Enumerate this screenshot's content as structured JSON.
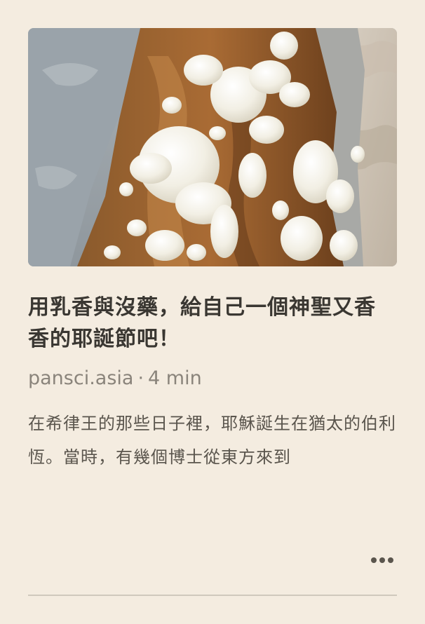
{
  "article": {
    "image_alt": "乳香",
    "title": "用乳香與沒藥，給自己一個神聖又香香的耶誕節吧！",
    "source": "pansci.asia",
    "separator": "·",
    "read_time": "4 min",
    "excerpt": "在希律王的那些日子裡，耶穌誕生在猶太的伯利恆。當時，有幾個博士從東方來到"
  },
  "actions": {
    "more_icon": "more-horizontal-icon"
  },
  "colors": {
    "background": "#f4ece0",
    "title": "#3a3732",
    "meta": "#8a847b",
    "excerpt": "#5a554d"
  }
}
